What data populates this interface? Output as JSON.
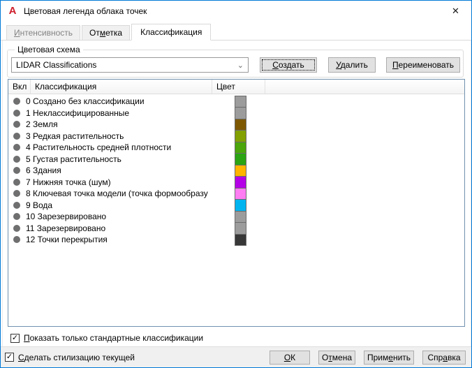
{
  "window": {
    "title": "Цветовая легенда облака точек",
    "icon_glyph": "A",
    "close_glyph": "✕"
  },
  "tabs": [
    {
      "pre": "",
      "key": "И",
      "post": "нтенсивность",
      "state": "disabled"
    },
    {
      "pre": "От",
      "key": "м",
      "post": "етка",
      "state": "normal"
    },
    {
      "pre": "Классификация",
      "key": "",
      "post": "",
      "state": "active"
    }
  ],
  "scheme": {
    "group_label": "Цветовая схема",
    "combo_value": "LIDAR Classifications",
    "combo_chevron": "⌄",
    "create_button": {
      "pre": "",
      "key": "С",
      "post": "оздать"
    },
    "delete_button": {
      "pre": "",
      "key": "У",
      "post": "далить"
    },
    "rename_button": {
      "pre": "",
      "key": "П",
      "post": "ереименовать"
    }
  },
  "table": {
    "columns": [
      "Вкл",
      "Классификация",
      "Цвет"
    ],
    "rows": [
      {
        "label": "0 Создано без классификации",
        "color": "#9C9C9C"
      },
      {
        "label": "1 Неклассифицированные",
        "color": "#9C9C9C"
      },
      {
        "label": "2 Земля",
        "color": "#7D5800"
      },
      {
        "label": "3 Редкая растительность",
        "color": "#82A000"
      },
      {
        "label": "4 Растительность средней плотности",
        "color": "#4AA60A"
      },
      {
        "label": "5 Густая растительность",
        "color": "#2AA413"
      },
      {
        "label": "6 Здания",
        "color": "#FFB400"
      },
      {
        "label": "7 Нижняя точка (шум)",
        "color": "#B400E6"
      },
      {
        "label": "8 Ключевая точка модели (точка формообразу",
        "color": "#FF7DF2"
      },
      {
        "label": "9 Вода",
        "color": "#00B4F0"
      },
      {
        "label": "10 Зарезервировано",
        "color": "#9C9C9C"
      },
      {
        "label": "11 Зарезервировано",
        "color": "#9C9C9C"
      },
      {
        "label": "12 Точки перекрытия",
        "color": "#373737"
      }
    ]
  },
  "show_standard_checkbox": {
    "checked": true,
    "check_glyph": "✓",
    "pre": "",
    "key": "П",
    "post": "оказать только стандартные классификации"
  },
  "footer": {
    "style_checkbox": {
      "checked": true,
      "check_glyph": "✓",
      "pre": "",
      "key": "С",
      "post": "делать стилизацию текущей"
    },
    "ok_button": {
      "pre": "",
      "key": "О",
      "post": "К"
    },
    "cancel_button": {
      "pre": "О",
      "key": "т",
      "post": "мена"
    },
    "apply_button": {
      "pre": "Прим",
      "key": "е",
      "post": "нить"
    },
    "help_button": {
      "pre": "Спр",
      "key": "а",
      "post": "вка"
    }
  }
}
